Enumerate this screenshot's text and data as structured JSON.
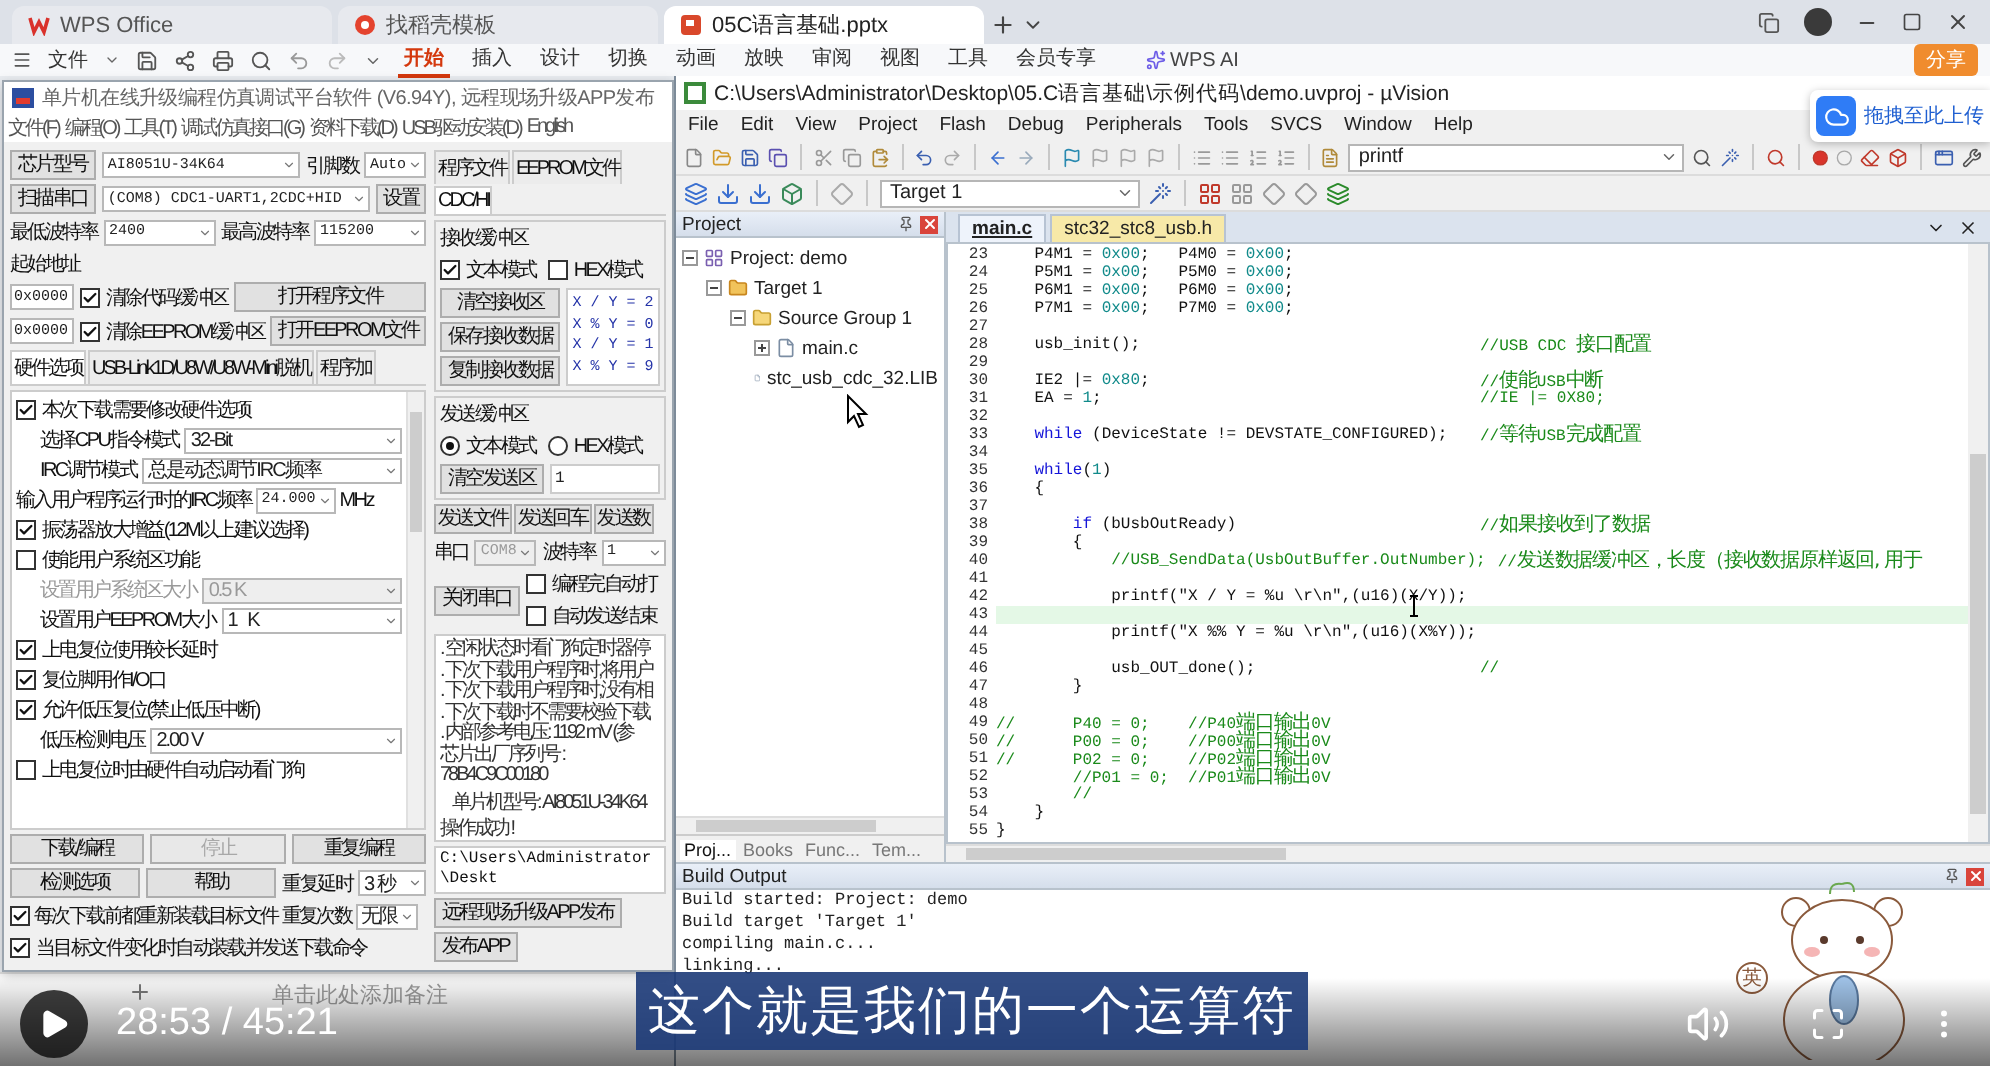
{
  "browser": {
    "tabs": [
      {
        "label": "WPS Office",
        "selected": false
      },
      {
        "label": "找稻壳模板",
        "selected": false
      },
      {
        "label": "05C语言基础.pptx",
        "selected": true
      }
    ]
  },
  "wps": {
    "file_menu": "文件",
    "ribbon_tabs": [
      {
        "label": "开始",
        "selected": true
      },
      {
        "label": "插入",
        "selected": false
      },
      {
        "label": "设计",
        "selected": false
      },
      {
        "label": "切换",
        "selected": false
      },
      {
        "label": "动画",
        "selected": false
      },
      {
        "label": "放映",
        "selected": false
      },
      {
        "label": "审阅",
        "selected": false
      },
      {
        "label": "视图",
        "selected": false
      },
      {
        "label": "工具",
        "selected": false
      },
      {
        "label": "会员专享",
        "selected": false
      }
    ],
    "ai": "WPS AI",
    "share": "分享",
    "notes_placeholder": "单击此处添加备注"
  },
  "isp": {
    "title": "单片机在线升级编程仿真调试平台软件 (V6.94Y), 远程现场升级APP发布",
    "menu": [
      "文件(F)",
      "编程(O)",
      "工具(T)",
      "调试仿真接口(G)",
      "资料下载(D)",
      "USB驱动安装(D)",
      "English"
    ],
    "chip": {
      "label": "芯片型号",
      "value": "AI8051U-34K64"
    },
    "pins": {
      "label": "引脚数",
      "value": "Auto"
    },
    "port": {
      "label": "扫描串口",
      "value": "(COM8) CDC1-UART1,2CDC+HID"
    },
    "port_settings": "设置",
    "min_baud": {
      "label": "最低波特率",
      "value": "2400"
    },
    "max_baud": {
      "label": "最高波特率",
      "value": "115200"
    },
    "start_address_label": "起始地址",
    "address_rows": [
      {
        "value": "0x0000",
        "label": "清除代码缓冲区",
        "checked": true,
        "button": "打开程序文件"
      },
      {
        "value": "0x0000",
        "label": "清除EEPROM缓冲区",
        "checked": true,
        "button": "打开EEPROM文件"
      }
    ],
    "option_tabs": [
      {
        "label": "硬件选项",
        "selected": true
      },
      {
        "label": "USB-Link1D/U8W/U8W-Mini脱机",
        "selected": false
      },
      {
        "label": "程序加",
        "selected": false
      }
    ],
    "options": [
      {
        "kind": "check",
        "label": "本次下载需要修改硬件选项",
        "checked": true
      },
      {
        "kind": "select",
        "label": "选择CPU指令模式",
        "value": "32-Bit",
        "disabled": false
      },
      {
        "kind": "select",
        "label": "IRC调节模式",
        "value": "总是动态调节IRC频率",
        "disabled": false
      },
      {
        "kind": "input",
        "label": "输入用户程序运行时的IRC频率",
        "value": "24.000",
        "unit": "MHz"
      },
      {
        "kind": "check",
        "label": "振荡器放大增益(12M以上建议选择)",
        "checked": true
      },
      {
        "kind": "check",
        "label": "使能用户系统区功能",
        "checked": false
      },
      {
        "kind": "select",
        "label": "设置用户系统区大小",
        "value": "0.5 K",
        "disabled": true
      },
      {
        "kind": "select",
        "label": "设置用户EEPROM大小",
        "value": "1   K",
        "disabled": false
      },
      {
        "kind": "check",
        "label": "上电复位使用较长延时",
        "checked": true
      },
      {
        "kind": "check",
        "label": "复位脚用作I/O口",
        "checked": true
      },
      {
        "kind": "check",
        "label": "允许低压复位(禁止低压中断)",
        "checked": true
      },
      {
        "kind": "select",
        "label": "低压检测电压",
        "value": "2.00 V",
        "disabled": false
      },
      {
        "kind": "check",
        "label": "上电复位时由硬件自动启动看门狗",
        "checked": false
      }
    ],
    "actions": [
      {
        "label": "下载/编程",
        "disabled": false
      },
      {
        "label": "停止",
        "disabled": true
      },
      {
        "label": "重复编程",
        "disabled": false
      },
      {
        "label": "检测选项",
        "disabled": false
      },
      {
        "label": "帮助",
        "disabled": false
      }
    ],
    "repeat_delay": {
      "label": "重复延时",
      "value": "3 秒"
    },
    "repeat_count": {
      "label": "重复次数",
      "value": "无限"
    },
    "reload_options": [
      {
        "label": "每次下载前都重新装载目标文件",
        "checked": true
      },
      {
        "label": "当目标文件变化时自动装载并发送下载命令",
        "checked": true
      }
    ],
    "file_tabs": [
      {
        "label": "程序文件",
        "selected": false
      },
      {
        "label": "EEPROM文件",
        "selected": false
      },
      {
        "label": "CDC/HI",
        "selected": true
      }
    ],
    "receive": {
      "title": "接收缓冲区",
      "modes": [
        {
          "label": "文本模式",
          "checked": true
        },
        {
          "label": "HEX模式",
          "checked": false
        }
      ],
      "buttons": [
        "清空接收区",
        "保存接收数据",
        "复制接收数据"
      ],
      "lines": [
        "X / Y = 2",
        "X % Y = 0",
        "X / Y = 1",
        "X % Y = 9"
      ]
    },
    "send": {
      "title": "发送缓冲区",
      "modes": [
        {
          "label": "文本模式",
          "selected": true
        },
        {
          "label": "HEX模式",
          "selected": false
        }
      ],
      "buttons": [
        "清空发送区"
      ],
      "text": "1"
    },
    "send_buttons": [
      "发送文件",
      "发送回车",
      "发送数"
    ],
    "serial": {
      "port_label": "串口",
      "port": "COM8",
      "baud_label": "波特率",
      "baud": "1"
    },
    "close_port": "关闭串口",
    "port_options": [
      {
        "label": "编程完自动打",
        "checked": false
      },
      {
        "label": "自动发送结束",
        "checked": false
      }
    ],
    "log": [
      {
        "kind": "note",
        "text": ". 空闲状态时看门狗定时器停"
      },
      {
        "kind": "note",
        "text": ". 下次下载用户程序时,将用户"
      },
      {
        "kind": "note",
        "text": ". 下次下载用户程序时,没有相"
      },
      {
        "kind": "note",
        "text": ". 下次下载时不需要校验下载"
      },
      {
        "kind": "note",
        "text": ". 内部参考电压: 1192 mV (参"
      },
      {
        "kind": "info",
        "text": "芯片出厂序列号 : 78B4C9C00180"
      },
      {
        "kind": "model",
        "text": "单片机型号: AI8051U-34K64"
      },
      {
        "kind": "result",
        "text": "操作成功 !"
      }
    ],
    "path": "C:\\Users\\Administrator\\Deskt",
    "publish_buttons": [
      "远程现场升级APP发布",
      "发布APP"
    ]
  },
  "uvision": {
    "title": "C:\\Users\\Administrator\\Desktop\\05.C语言基础\\示例代码\\demo.uvproj - µVision",
    "menu": [
      "File",
      "Edit",
      "View",
      "Project",
      "Flash",
      "Debug",
      "Peripherals",
      "Tools",
      "SVCS",
      "Window",
      "Help"
    ],
    "find_combo": "printf",
    "target_combo": "Target 1",
    "project_panel": {
      "title": "Project",
      "tree": [
        {
          "kind": "project",
          "label": "Project: demo",
          "expanded": true,
          "children": [
            {
              "kind": "target",
              "label": "Target 1",
              "expanded": true,
              "children": [
                {
                  "kind": "group",
                  "label": "Source Group 1",
                  "expanded": true,
                  "children": [
                    {
                      "kind": "file",
                      "label": "main.c",
                      "expanded": false
                    },
                    {
                      "kind": "file",
                      "label": "stc_usb_cdc_32.LIB"
                    }
                  ]
                }
              ]
            }
          ]
        }
      ],
      "tabs": [
        {
          "label": "Proj...",
          "selected": true
        },
        {
          "label": "Books",
          "selected": false
        },
        {
          "label": "Func...",
          "selected": false
        },
        {
          "label": "Tem...",
          "selected": false
        }
      ]
    },
    "editor": {
      "tabs": [
        {
          "label": "main.c",
          "selected": true
        },
        {
          "label": "stc32_stc8_usb.h",
          "selected": false
        }
      ],
      "lines": [
        {
          "number": "23",
          "current": false,
          "code": [
            {
              "kind": "plain",
              "text": "    P4M1 = "
            },
            {
              "kind": "number",
              "text": "0x00"
            },
            {
              "kind": "plain",
              "text": ";   P4M0 = "
            },
            {
              "kind": "number",
              "text": "0x00"
            },
            {
              "kind": "plain",
              "text": ";"
            }
          ]
        },
        {
          "number": "24",
          "current": false,
          "code": [
            {
              "kind": "plain",
              "text": "    P5M1 = "
            },
            {
              "kind": "number",
              "text": "0x00"
            },
            {
              "kind": "plain",
              "text": ";   P5M0 = "
            },
            {
              "kind": "number",
              "text": "0x00"
            },
            {
              "kind": "plain",
              "text": ";"
            }
          ]
        },
        {
          "number": "25",
          "current": false,
          "code": [
            {
              "kind": "plain",
              "text": "    P6M1 = "
            },
            {
              "kind": "number",
              "text": "0x00"
            },
            {
              "kind": "plain",
              "text": ";   P6M0 = "
            },
            {
              "kind": "number",
              "text": "0x00"
            },
            {
              "kind": "plain",
              "text": ";"
            }
          ]
        },
        {
          "number": "26",
          "current": false,
          "code": [
            {
              "kind": "plain",
              "text": "    P7M1 = "
            },
            {
              "kind": "number",
              "text": "0x00"
            },
            {
              "kind": "plain",
              "text": ";   P7M0 = "
            },
            {
              "kind": "number",
              "text": "0x00"
            },
            {
              "kind": "plain",
              "text": ";"
            }
          ]
        },
        {
          "number": "27",
          "current": false
        },
        {
          "number": "28",
          "current": false,
          "code": [
            {
              "kind": "plain",
              "text": "    usb_init();"
            }
          ],
          "note": [
            {
              "kind": "comment",
              "text": "//USB CDC "
            },
            {
              "kind": "comment_wide",
              "text": "接口配置"
            }
          ]
        },
        {
          "number": "29",
          "current": false
        },
        {
          "number": "30",
          "current": false,
          "code": [
            {
              "kind": "plain",
              "text": "    IE2 |= "
            },
            {
              "kind": "number",
              "text": "0x80"
            },
            {
              "kind": "plain",
              "text": ";"
            }
          ],
          "note": [
            {
              "kind": "comment",
              "text": "//"
            },
            {
              "kind": "comment_wide",
              "text": "使能"
            },
            {
              "kind": "comment",
              "text": "USB"
            },
            {
              "kind": "comment_wide",
              "text": "中断"
            }
          ]
        },
        {
          "number": "31",
          "current": false,
          "code": [
            {
              "kind": "plain",
              "text": "    EA = "
            },
            {
              "kind": "number",
              "text": "1"
            },
            {
              "kind": "plain",
              "text": ";"
            }
          ],
          "note": [
            {
              "kind": "comment",
              "text": "//IE |= 0X80;"
            }
          ]
        },
        {
          "number": "32",
          "current": false
        },
        {
          "number": "33",
          "current": false,
          "code": [
            {
              "kind": "keyword",
              "text": "    while"
            },
            {
              "kind": "plain",
              "text": " (DeviceState != DEVSTATE_CONFIGURED);"
            }
          ],
          "note": [
            {
              "kind": "comment",
              "text": "//"
            },
            {
              "kind": "comment_wide",
              "text": "等待"
            },
            {
              "kind": "comment",
              "text": "USB"
            },
            {
              "kind": "comment_wide",
              "text": "完成配置"
            }
          ]
        },
        {
          "number": "34",
          "current": false
        },
        {
          "number": "35",
          "current": false,
          "code": [
            {
              "kind": "keyword",
              "text": "    while"
            },
            {
              "kind": "plain",
              "text": "("
            },
            {
              "kind": "number",
              "text": "1"
            },
            {
              "kind": "plain",
              "text": ")"
            }
          ]
        },
        {
          "number": "36",
          "current": false,
          "code": [
            {
              "kind": "plain",
              "text": "    {"
            }
          ]
        },
        {
          "number": "37",
          "current": false
        },
        {
          "number": "38",
          "current": false,
          "code": [
            {
              "kind": "keyword",
              "text": "        if"
            },
            {
              "kind": "plain",
              "text": " (bUsbOutReady)"
            }
          ],
          "note": [
            {
              "kind": "comment",
              "text": "//"
            },
            {
              "kind": "comment_wide",
              "text": "如果接收到了数据"
            }
          ]
        },
        {
          "number": "39",
          "current": false,
          "code": [
            {
              "kind": "plain",
              "text": "        {"
            }
          ]
        },
        {
          "number": "40",
          "current": false,
          "code": [
            {
              "kind": "comment",
              "text": "            //USB_SendData(UsbOutBuffer.OutNumber);"
            }
          ],
          "note": [
            {
              "kind": "comment",
              "text": "//"
            },
            {
              "kind": "comment_wide",
              "text": "发送数据缓冲区，长度（接收数据原样返回, 用于"
            }
          ]
        },
        {
          "number": "41",
          "current": false
        },
        {
          "number": "42",
          "current": false,
          "code": [
            {
              "kind": "plain",
              "text": "            printf(\"X / Y = %u \\r\\n\",(u16)(X/Y));"
            }
          ]
        },
        {
          "number": "43",
          "current": true
        },
        {
          "number": "44",
          "current": false,
          "code": [
            {
              "kind": "plain",
              "text": "            printf(\"X %% Y = %u \\r\\n\",(u16)(X%Y));"
            }
          ]
        },
        {
          "number": "45",
          "current": false
        },
        {
          "number": "46",
          "current": false,
          "code": [
            {
              "kind": "plain",
              "text": "            usb_OUT_done();"
            }
          ],
          "note": [
            {
              "kind": "comment",
              "text": "//"
            }
          ]
        },
        {
          "number": "47",
          "current": false,
          "code": [
            {
              "kind": "plain",
              "text": "        }"
            }
          ]
        },
        {
          "number": "48",
          "current": false
        },
        {
          "number": "49",
          "current": false,
          "code": [
            {
              "kind": "comment",
              "text": "//      P40 = 0;    //P40"
            },
            {
              "kind": "comment_wide",
              "text": "端口输出"
            },
            {
              "kind": "comment",
              "text": "0V"
            }
          ]
        },
        {
          "number": "50",
          "current": false,
          "code": [
            {
              "kind": "comment",
              "text": "//      P00 = 0;    //P00"
            },
            {
              "kind": "comment_wide",
              "text": "端口输出"
            },
            {
              "kind": "comment",
              "text": "0V"
            }
          ]
        },
        {
          "number": "51",
          "current": false,
          "code": [
            {
              "kind": "comment",
              "text": "//      P02 = 0;    //P02"
            },
            {
              "kind": "comment_wide",
              "text": "端口输出"
            },
            {
              "kind": "comment",
              "text": "0V"
            }
          ]
        },
        {
          "number": "52",
          "current": false,
          "code": [
            {
              "kind": "comment",
              "text": "        //P01 = 0;  //P01"
            },
            {
              "kind": "comment_wide",
              "text": "端口输出"
            },
            {
              "kind": "comment",
              "text": "0V"
            }
          ]
        },
        {
          "number": "53",
          "current": false,
          "code": [
            {
              "kind": "comment",
              "text": "        //"
            }
          ]
        },
        {
          "number": "54",
          "current": false,
          "code": [
            {
              "kind": "plain",
              "text": "    }"
            }
          ]
        },
        {
          "number": "55",
          "current": false,
          "code": [
            {
              "kind": "plain",
              "text": "}"
            }
          ]
        }
      ]
    },
    "build_output": {
      "title": "Build Output",
      "lines": [
        "Build started: Project: demo",
        "Build target 'Target 1'",
        "compiling main.c...",
        "linking..."
      ]
    }
  },
  "upload_hint": "拖拽至此上传",
  "sticker": {
    "badge": "英"
  },
  "video": {
    "time": "28:53 / 45:21",
    "subtitle": "这个就是我们的一个运算符"
  }
}
